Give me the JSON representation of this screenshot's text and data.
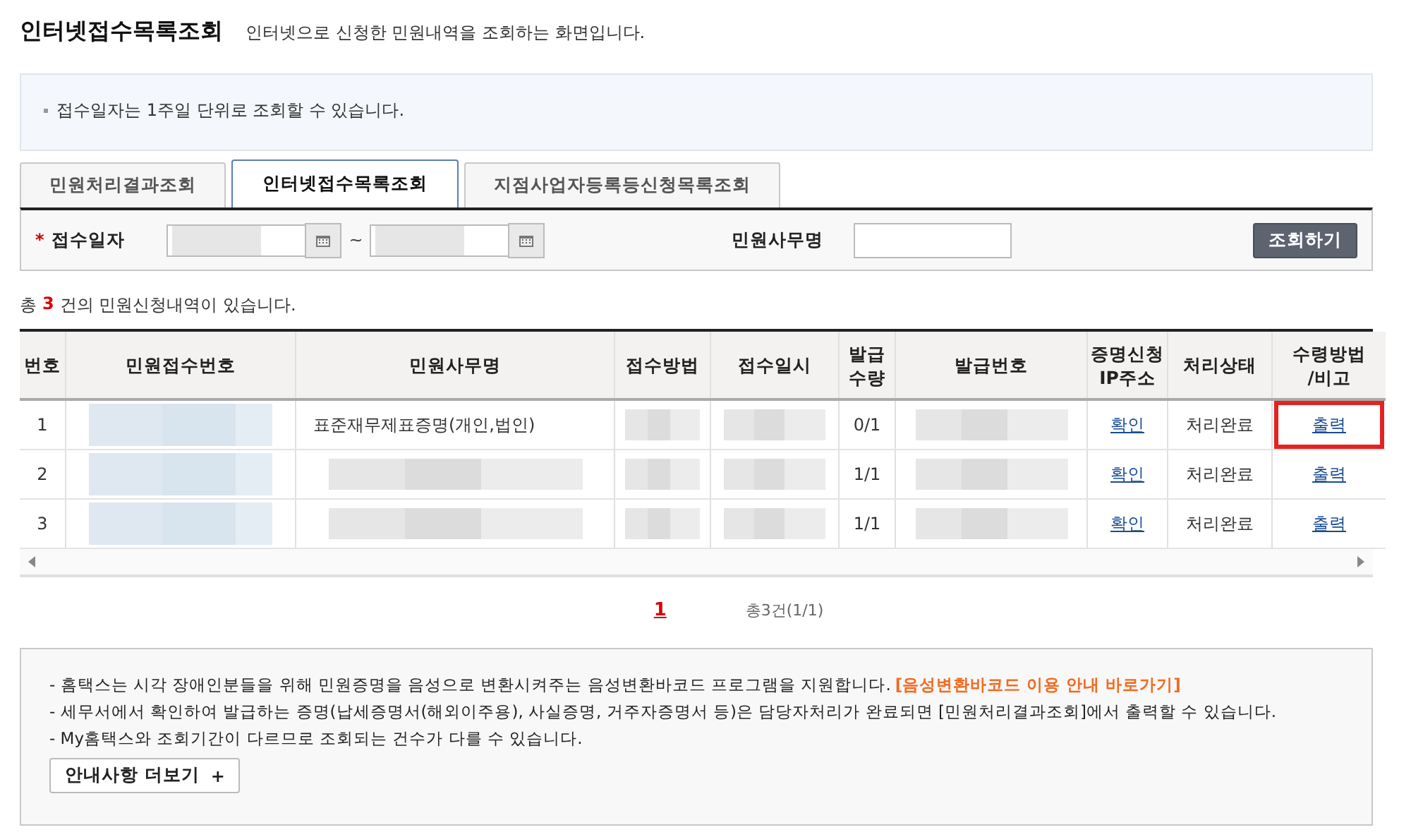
{
  "header": {
    "title": "인터넷접수목록조회",
    "subtitle": "인터넷으로 신청한 민원내역을 조회하는 화면입니다."
  },
  "info": [
    "접수일자는 1주일 단위로 조회할 수 있습니다."
  ],
  "tabs": [
    {
      "label": "민원처리결과조회",
      "selected": false
    },
    {
      "label": "인터넷접수목록조회",
      "selected": true
    },
    {
      "label": "지점사업자등록등신청목록조회",
      "selected": false
    }
  ],
  "search": {
    "date_label": "접수일자",
    "required_mark": "*",
    "separator": "~",
    "name_label": "민원사무명",
    "button": "조회하기"
  },
  "summary": {
    "prefix": "총",
    "count": "3",
    "suffix": "건의 민원신청내역이 있습니다."
  },
  "table": {
    "columns": [
      {
        "label": "번호",
        "kind": "text"
      },
      {
        "label": "민원접수번호",
        "kind": "text"
      },
      {
        "label": "민원사무명",
        "kind": "text"
      },
      {
        "label": "접수방법",
        "kind": "text"
      },
      {
        "label": "접수일시",
        "kind": "text"
      },
      {
        "label": "발급\n수량",
        "kind": "text"
      },
      {
        "label": "발급번호",
        "kind": "text"
      },
      {
        "label": "증명신청\nIP주소",
        "kind": "link"
      },
      {
        "label": "처리상태",
        "kind": "text"
      },
      {
        "label": "수령방법\n/비고",
        "kind": "link"
      }
    ],
    "rows": [
      {
        "cells": [
          "1",
          null,
          "표준재무제표증명(개인,법인)",
          null,
          null,
          "0/1",
          null,
          "확인",
          "처리완료",
          "출력"
        ],
        "highlighted": true
      },
      {
        "cells": [
          "2",
          null,
          null,
          null,
          null,
          "1/1",
          null,
          "확인",
          "처리완료",
          "출력"
        ],
        "highlighted": false
      },
      {
        "cells": [
          "3",
          null,
          null,
          null,
          null,
          "1/1",
          null,
          "확인",
          "처리완료",
          "출력"
        ],
        "highlighted": false
      }
    ]
  },
  "pager": {
    "pages": [
      {
        "label": "1",
        "selected": true
      }
    ],
    "total": "총3건(1/1)"
  },
  "notice": {
    "lines": [
      {
        "text": "- 홈택스는 시각 장애인분들을 위해 민원증명을 음성으로 변환시켜주는 음성변환바코드 프로그램을 지원합니다.",
        "link": "[음성변환바코드 이용 안내 바로가기]"
      },
      {
        "text": "- 세무서에서 확인하여 발급하는 증명(납세증명서(해외이주용), 사실증명, 거주자증명서 등)은 담당자처리가 완료되면 [민원처리결과조회]에서 출력할 수 있습니다."
      },
      {
        "text": "- My홈택스와 조회기간이 다르므로 조회되는 건수가 다를 수 있습니다."
      }
    ],
    "button": "안내사항 더보기",
    "button_icon": "+"
  }
}
